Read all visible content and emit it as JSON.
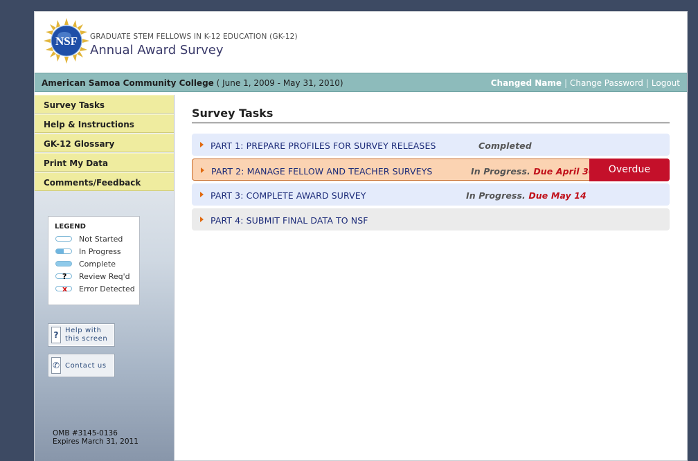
{
  "header": {
    "logo_text": "NSF",
    "program": "GRADUATE STEM FELLOWS IN K-12 EDUCATION (GK-12)",
    "title": "Annual Award Survey"
  },
  "statusbar": {
    "organization": "American Samoa Community College",
    "period": "( June 1, 2009 - May 31, 2010)",
    "user": "Changed Name",
    "sep1": "|",
    "change_password": "Change Password",
    "sep2": "|",
    "logout": "Logout"
  },
  "sidebar": {
    "items": [
      {
        "label": "Survey Tasks"
      },
      {
        "label": "Help & Instructions"
      },
      {
        "label": "GK-12 Glossary"
      },
      {
        "label": "Print My Data"
      },
      {
        "label": "Comments/Feedback"
      }
    ],
    "legend": {
      "title": "LEGEND",
      "entries": [
        {
          "label": "Not Started"
        },
        {
          "label": "In Progress"
        },
        {
          "label": "Complete"
        },
        {
          "label": "Review Req'd",
          "mark": "?"
        },
        {
          "label": "Error Detected",
          "mark": "x"
        }
      ]
    },
    "help_button": {
      "line1": "Help with",
      "line2": "this screen",
      "icon": "?"
    },
    "contact_button": {
      "label": "Contact us"
    },
    "omb_number": "OMB #3145-0136",
    "omb_expires": "Expires March 31, 2011"
  },
  "main": {
    "title": "Survey Tasks",
    "tasks": [
      {
        "name": "PART 1: PREPARE PROFILES FOR SURVEY RELEASES",
        "status": "Completed",
        "due": ""
      },
      {
        "name": "PART 2: MANAGE FELLOW AND TEACHER SURVEYS",
        "status": "In Progress.",
        "due": "Due April 30",
        "flag": "Overdue"
      },
      {
        "name": "PART 3: COMPLETE AWARD SURVEY",
        "status": "In Progress.",
        "due": "Due May 14"
      },
      {
        "name": "PART 4: SUBMIT FINAL DATA TO NSF",
        "status": "",
        "due": ""
      }
    ]
  },
  "colors": {
    "statusbar": "#8dbbbb",
    "nav_item": "#efec9f",
    "overdue": "#c4102a",
    "task_blue": "#e4ebfb",
    "task_orange": "#fbd3b2",
    "due_text": "#c0101a"
  }
}
